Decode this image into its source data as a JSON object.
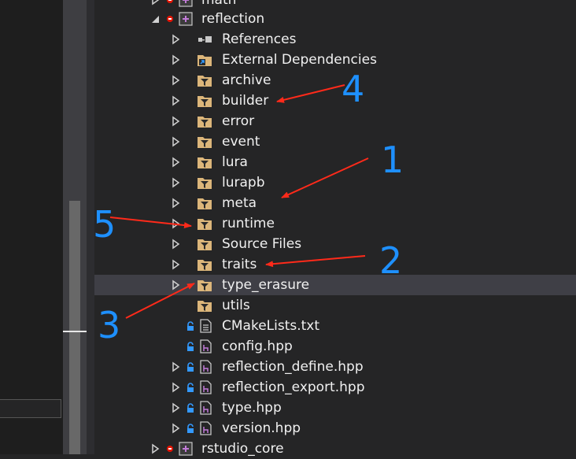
{
  "tree": {
    "rows": [
      {
        "label": "math"
      },
      {
        "label": "reflection"
      },
      {
        "label": "References"
      },
      {
        "label": "External Dependencies"
      },
      {
        "label": "archive"
      },
      {
        "label": "builder"
      },
      {
        "label": "error"
      },
      {
        "label": "event"
      },
      {
        "label": "lura"
      },
      {
        "label": "lurapb"
      },
      {
        "label": "meta"
      },
      {
        "label": "runtime"
      },
      {
        "label": "Source Files"
      },
      {
        "label": "traits"
      },
      {
        "label": "type_erasure"
      },
      {
        "label": "utils"
      },
      {
        "label": "CMakeLists.txt"
      },
      {
        "label": "config.hpp"
      },
      {
        "label": "reflection_define.hpp"
      },
      {
        "label": "reflection_export.hpp"
      },
      {
        "label": "type.hpp"
      },
      {
        "label": "version.hpp"
      },
      {
        "label": "rstudio_core"
      }
    ]
  },
  "annotations": [
    {
      "label": "4",
      "color": "#1e90ff"
    },
    {
      "label": "1",
      "color": "#1e90ff"
    },
    {
      "label": "5",
      "color": "#1e90ff"
    },
    {
      "label": "2",
      "color": "#1e90ff"
    },
    {
      "label": "3",
      "color": "#1e90ff"
    }
  ],
  "arrow_color": "#ff2a1a"
}
